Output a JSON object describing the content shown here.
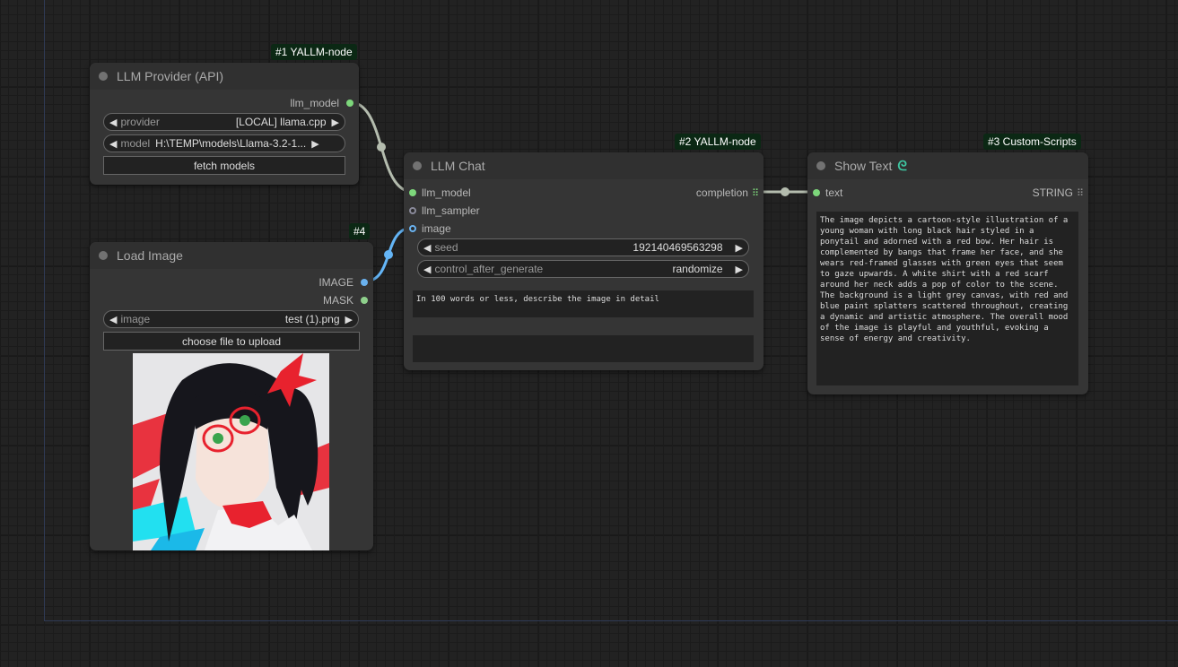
{
  "nodes": {
    "provider": {
      "badge": "#1 YALLM-node",
      "title": "LLM Provider (API)",
      "output": "llm_model",
      "widgets": [
        {
          "label": "provider",
          "value": "[LOCAL] llama.cpp"
        },
        {
          "label": "model",
          "value": "H:\\TEMP\\models\\Llama-3.2-1..."
        }
      ],
      "button": "fetch models"
    },
    "load_image": {
      "badge": "#4",
      "title": "Load Image",
      "outputs": [
        "IMAGE",
        "MASK"
      ],
      "widget": {
        "label": "image",
        "value": "test (1).png"
      },
      "button": "choose file to upload"
    },
    "chat": {
      "badge": "#2 YALLM-node",
      "title": "LLM Chat",
      "inputs": [
        "llm_model",
        "llm_sampler",
        "image"
      ],
      "output": "completion",
      "widgets": [
        {
          "label": "seed",
          "value": "192140469563298"
        },
        {
          "label": "control_after_generate",
          "value": "randomize"
        }
      ],
      "prompt": "In 100 words or less, describe the image in detail",
      "system": ""
    },
    "show_text": {
      "badge": "#3 Custom-Scripts",
      "title": "Show Text",
      "input": "text",
      "output": "STRING",
      "text": "The image depicts a cartoon-style illustration of a young woman with long black hair styled in a ponytail and adorned with a red bow. Her hair is complemented by bangs that frame her face, and she wears red-framed glasses with green eyes that seem to gaze upwards. A white shirt with a red scarf around her neck adds a pop of color to the scene. The background is a light grey canvas, with red and blue paint splatters scattered throughout, creating a dynamic and artistic atmosphere. The overall mood of the image is playful and youthful, evoking a sense of energy and creativity."
    }
  },
  "icons": {
    "arrow_left": "◀",
    "arrow_right": "▶",
    "link": "link-icon",
    "grid": "grid-icon"
  },
  "colors": {
    "link_model": "#b4bcae",
    "link_image": "#64b5f6",
    "slot_green": "#7dd77b",
    "slot_blue": "#6ab2ef",
    "badge_bg": "#0b2814"
  }
}
